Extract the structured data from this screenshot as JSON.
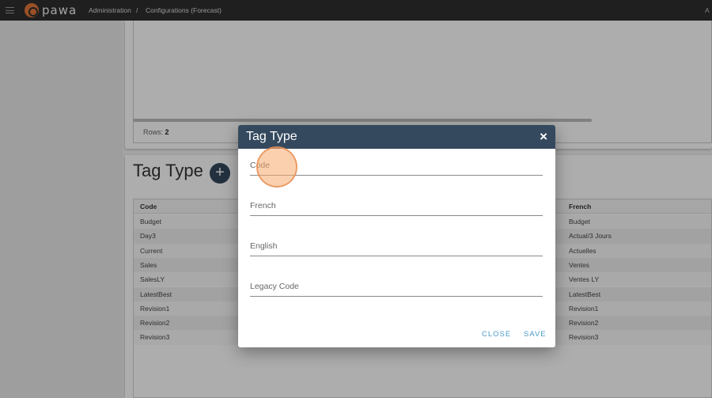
{
  "topbar": {
    "logo_text": "pawa",
    "breadcrumb": [
      "Administration",
      "/",
      "Configurations (Forecast)"
    ],
    "user_partial": "A"
  },
  "top_grid": {
    "rows_label": "Rows:",
    "rows_count": "2"
  },
  "section": {
    "title": "Tag Type",
    "add_label": "+"
  },
  "table": {
    "columns": [
      "Code",
      "French"
    ],
    "rows": [
      [
        "Budget",
        "Budget"
      ],
      [
        "Day3",
        "Actual/3 Jours"
      ],
      [
        "Current",
        "Actuelles"
      ],
      [
        "Sales",
        "Ventes"
      ],
      [
        "SalesLY",
        "Ventes LY"
      ],
      [
        "LatestBest",
        "LatestBest"
      ],
      [
        "Revision1",
        "Revision1"
      ],
      [
        "Revision2",
        "Revision2"
      ],
      [
        "Revision3",
        "Revision3"
      ]
    ]
  },
  "dialog": {
    "title": "Tag Type",
    "close_icon": "×",
    "fields": [
      {
        "label": "Code",
        "value": ""
      },
      {
        "label": "French",
        "value": ""
      },
      {
        "label": "English",
        "value": ""
      },
      {
        "label": "Legacy Code",
        "value": ""
      }
    ],
    "close_label": "CLOSE",
    "save_label": "SAVE"
  },
  "colors": {
    "header": "#34495e",
    "accent": "#4a9bc8",
    "logo": "#e2773a"
  }
}
